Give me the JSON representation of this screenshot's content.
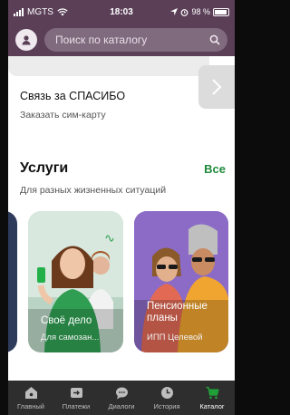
{
  "status_bar": {
    "carrier": "MGTS",
    "time": "18:03",
    "battery": "98 %"
  },
  "header": {
    "search_placeholder": "Поиск по каталогу"
  },
  "promo": {
    "title": "Связь за СПАСИБО",
    "subtitle": "Заказать сим-карту"
  },
  "services": {
    "title": "Услуги",
    "all_link": "Все",
    "subtitle": "Для разных жизненных ситуаций",
    "cards": [
      {
        "title": "Своё дело",
        "subtitle": "Для самозан..."
      },
      {
        "title": "Пенсионные планы",
        "subtitle": "ИПП Целевой"
      }
    ]
  },
  "tabbar": {
    "items": [
      {
        "label": "Главный",
        "icon": "home-icon",
        "active": false
      },
      {
        "label": "Платежи",
        "icon": "transfer-icon",
        "active": false
      },
      {
        "label": "Диалоги",
        "icon": "chat-icon",
        "active": false
      },
      {
        "label": "История",
        "icon": "clock-icon",
        "active": false
      },
      {
        "label": "Каталог",
        "icon": "cart-icon",
        "active": true
      }
    ]
  },
  "colors": {
    "header_bg": "#5a3f57",
    "accent_green": "#1f8a3a",
    "tabbar_bg": "#2e2e2e",
    "active_tab_icon": "#21a038"
  }
}
